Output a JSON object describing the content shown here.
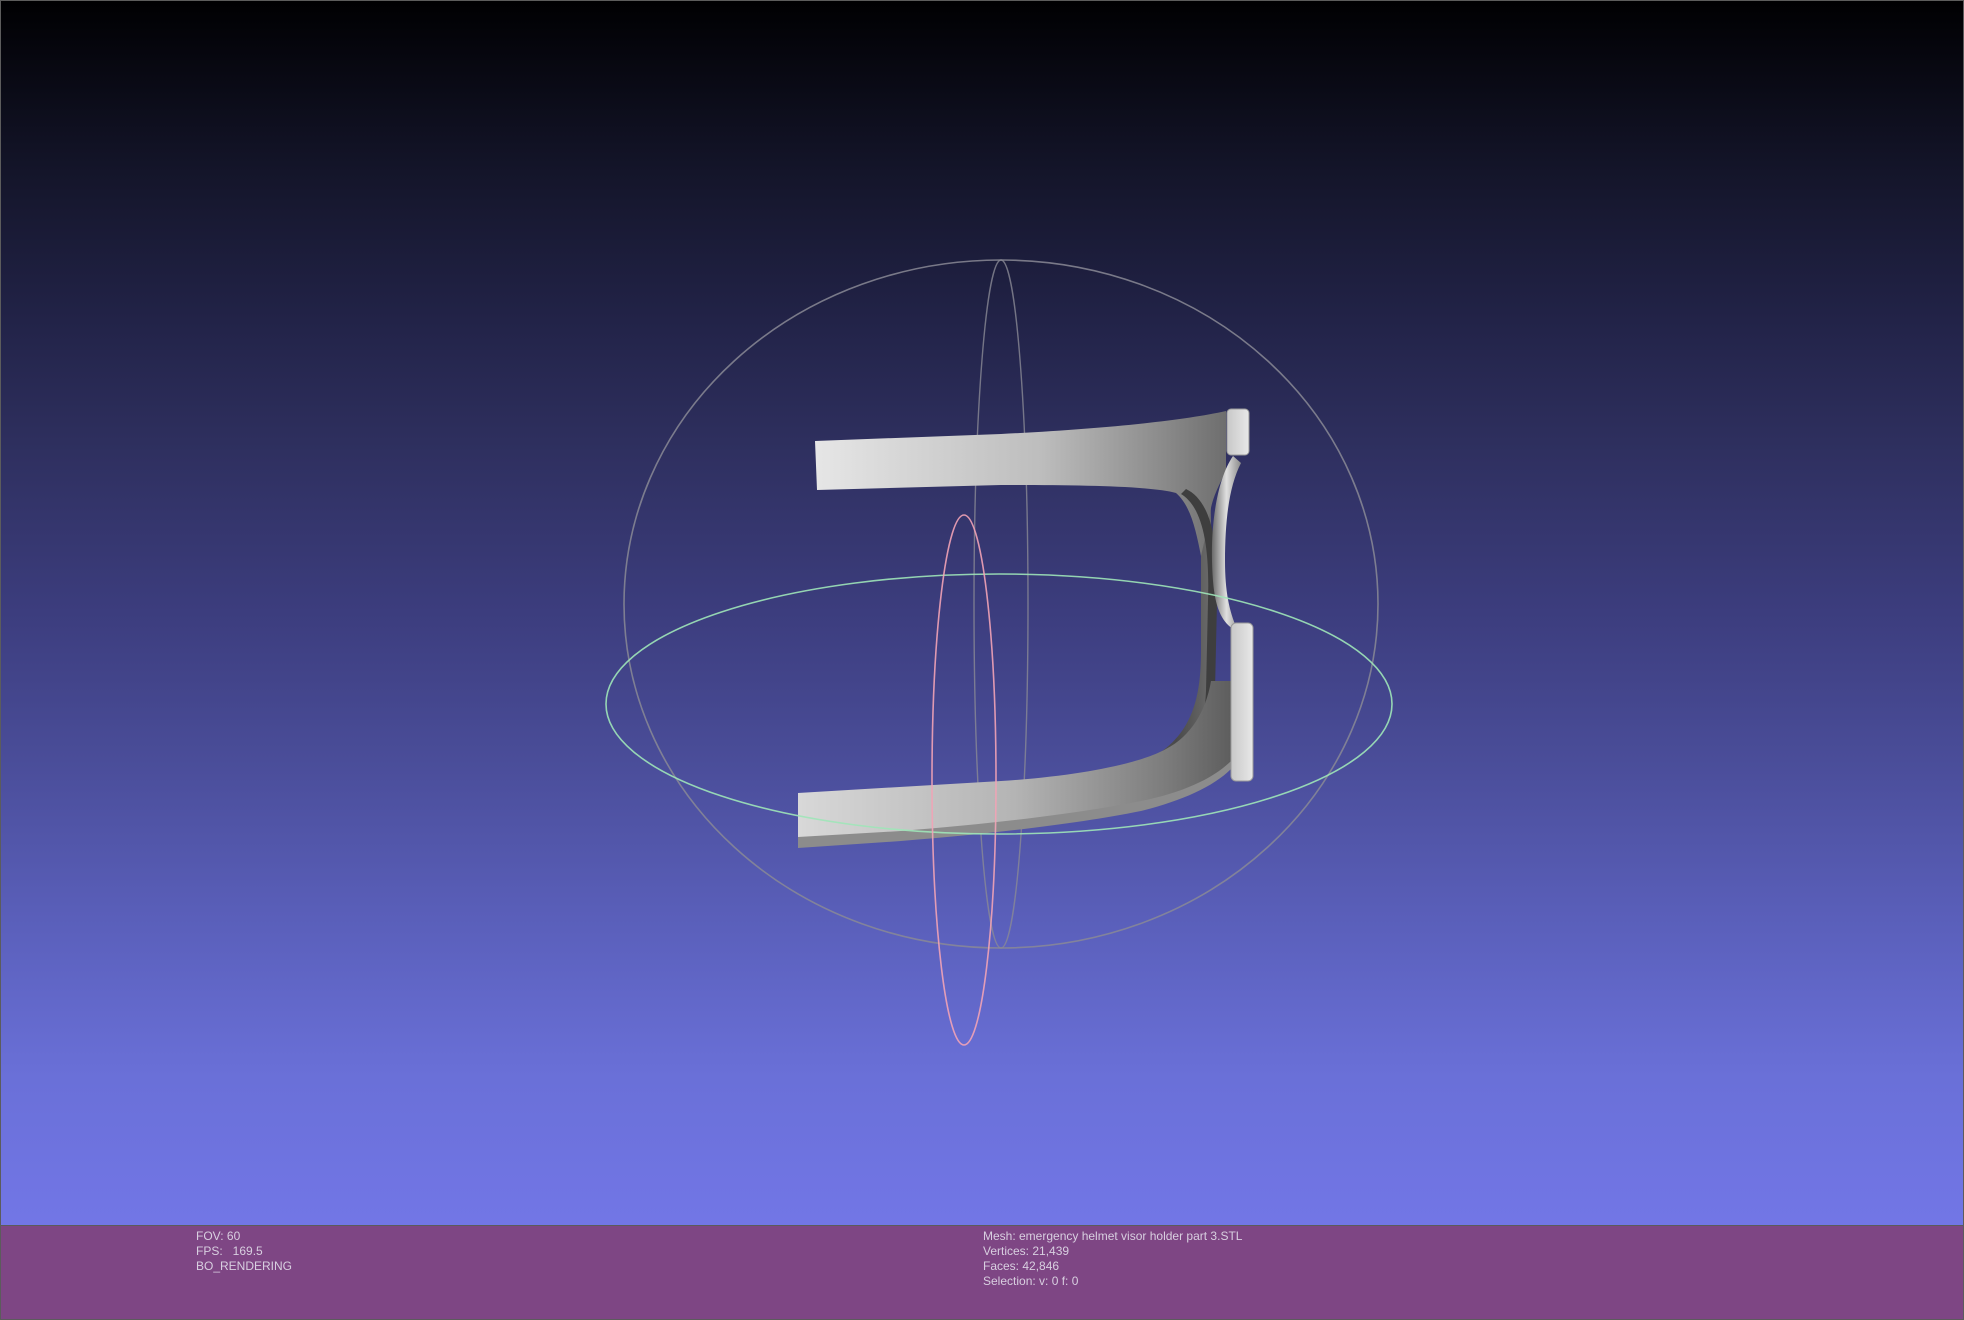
{
  "window": {
    "background_top": "#000002",
    "background_bottom": "#7276e6",
    "info_bar_color": "#7e4684"
  },
  "viewport": {
    "trackball": {
      "horizontal_ring_color": "#9fe6b8",
      "vertical_ring_color": "#f2a3b6",
      "outline_color": "#8a8a95"
    },
    "mesh_color": "#d9d9d9"
  },
  "render_info": {
    "fov": "FOV: 60",
    "fps": "FPS:   169.5",
    "mode": "BO_RENDERING"
  },
  "mesh_info": {
    "mesh": "Mesh: emergency helmet visor holder part 3.STL",
    "vertices": "Vertices: 21,439",
    "faces": "Faces: 42,846",
    "selection": "Selection: v: 0 f: 0"
  }
}
